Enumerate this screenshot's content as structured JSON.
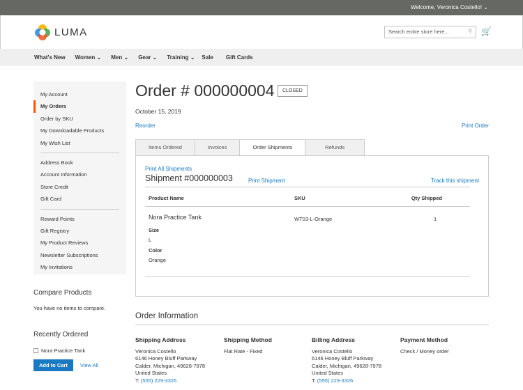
{
  "topbar": {
    "welcome": "Welcome, Veronica Costello! ⌄"
  },
  "header": {
    "logo": "LUMA",
    "search_placeholder": "Search entire store here...",
    "search_icon": "⚲",
    "cart_icon": "🛒"
  },
  "nav": [
    "What's New",
    "Women ⌄",
    "Men ⌄",
    "Gear ⌄",
    "Training ⌄",
    "Sale",
    "Gift Cards"
  ],
  "sidebar": {
    "group1": [
      "My Account",
      "My Orders",
      "Order by SKU",
      "My Downloadable Products",
      "My Wish List"
    ],
    "group2": [
      "Address Book",
      "Account Information",
      "Store Credit",
      "Gift Card"
    ],
    "group3": [
      "Reward Points",
      "Gift Registry",
      "My Product Reviews",
      "Newsletter Subscriptions",
      "My Invitations"
    ]
  },
  "compare": {
    "title": "Compare Products",
    "text": "You have no items to compare."
  },
  "recent": {
    "title": "Recently Ordered",
    "item": "Nora Practice Tank",
    "add_to_cart": "Add to Cart",
    "view_all": "View All"
  },
  "order": {
    "title": "Order # 000000004",
    "status": "CLOSED",
    "date": "October 15, 2019",
    "reorder": "Reorder",
    "print_order": "Print Order",
    "tabs": [
      "Items Ordered",
      "Invoices",
      "Order Shipments",
      "Refunds"
    ],
    "print_all": "Print All Shipments",
    "shipment": "Shipment #000000003",
    "print_shipment": "Print Shipment",
    "track": "Track this shipment",
    "columns": [
      "Product Name",
      "SKU",
      "Qty Shipped"
    ],
    "item": {
      "name": "Nora Practice Tank",
      "sku": "WT03-L-Orange",
      "qty": "1",
      "size_label": "Size",
      "size": "L",
      "color_label": "Color",
      "color": "Orange"
    }
  },
  "info": {
    "title": "Order Information",
    "shipping_address": {
      "title": "Shipping Address",
      "lines": [
        "Veronica Costello",
        "6146 Honey Bluff Parkway",
        "Calder, Michigan, 49628-7978",
        "United States"
      ],
      "phone_prefix": "T: ",
      "phone": "(555) 229-3326"
    },
    "shipping_method": {
      "title": "Shipping Method",
      "text": "Flat Rate - Fixed"
    },
    "billing_address": {
      "title": "Billing Address",
      "lines": [
        "Veronica Costello",
        "6146 Honey Bluff Parkway",
        "Calder, Michigan, 49628-7978",
        "United States"
      ],
      "phone_prefix": "T: ",
      "phone": "(555) 229-3326"
    },
    "payment_method": {
      "title": "Payment Method",
      "text": "Check / Money order"
    }
  }
}
